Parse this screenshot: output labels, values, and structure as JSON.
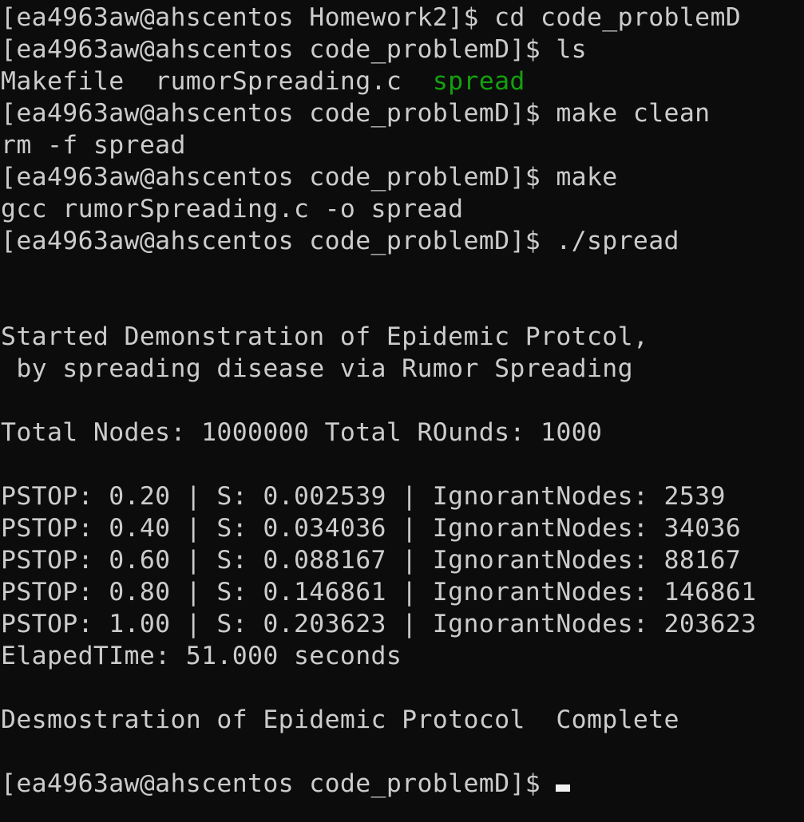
{
  "prompt": "[ea4963aw@ahscentos code_problemD]$ ",
  "lines": {
    "l1": "[ea4963aw@ahscentos Homework2]$ cd code_problemD",
    "l2": "[ea4963aw@ahscentos code_problemD]$ ls",
    "l3_a": "Makefile  rumorSpreading.c  ",
    "l3_b": "spread",
    "l4": "[ea4963aw@ahscentos code_problemD]$ make clean",
    "l5": "rm -f spread",
    "l6": "[ea4963aw@ahscentos code_problemD]$ make",
    "l7": "gcc rumorSpreading.c -o spread",
    "l8": "[ea4963aw@ahscentos code_problemD]$ ./spread",
    "l9": "",
    "l10": "",
    "l11": "Started Demonstration of Epidemic Protcol,",
    "l12": " by spreading disease via Rumor Spreading",
    "l13": "",
    "l14": "Total Nodes: 1000000 Total ROunds: 1000",
    "l15": "",
    "l16": "PSTOP: 0.20 | S: 0.002539 | IgnorantNodes: 2539",
    "l17": "PSTOP: 0.40 | S: 0.034036 | IgnorantNodes: 34036",
    "l18": "PSTOP: 0.60 | S: 0.088167 | IgnorantNodes: 88167",
    "l19": "PSTOP: 0.80 | S: 0.146861 | IgnorantNodes: 146861",
    "l20": "PSTOP: 1.00 | S: 0.203623 | IgnorantNodes: 203623",
    "l21": "ElapedTIme: 51.000 seconds",
    "l22": "",
    "l23": "Desmostration of Epidemic Protocol  Complete",
    "l24": "",
    "l25": "[ea4963aw@ahscentos code_problemD]$ "
  },
  "colors": {
    "background": "#0c0c0c",
    "foreground": "#cccccc",
    "executable": "#13a10e",
    "cursor": "#f2f2f2"
  }
}
